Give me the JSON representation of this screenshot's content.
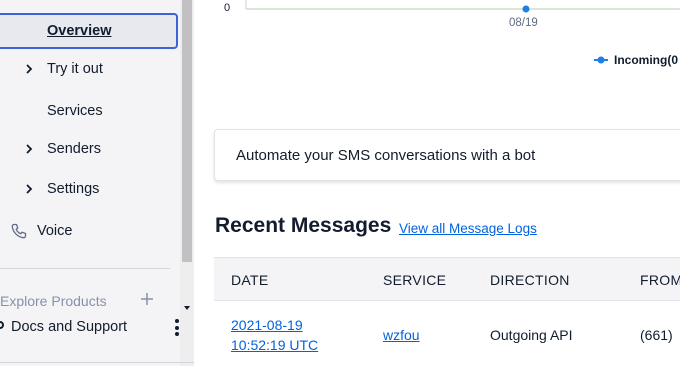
{
  "sidebar": {
    "items": [
      {
        "label": "Overview",
        "active": true,
        "chevron": false
      },
      {
        "label": "Try it out",
        "chevron": true
      },
      {
        "label": "Services",
        "chevron": false
      },
      {
        "label": "Senders",
        "chevron": true
      },
      {
        "label": "Settings",
        "chevron": true
      }
    ],
    "voice_label": "Voice",
    "explore_label": "Explore Products",
    "docs_label": "Docs and Support"
  },
  "chart_data": {
    "type": "line",
    "y_tick_labels": [
      "0"
    ],
    "x_tick_labels": [
      "08/19"
    ],
    "series": [
      {
        "name": "Incoming(0",
        "color": "#1f7ee8"
      }
    ]
  },
  "bot_card": {
    "text": "Automate your SMS conversations with a bot"
  },
  "recent": {
    "title": "Recent Messages",
    "link": "View all Message Logs",
    "columns": [
      "DATE",
      "SERVICE",
      "DIRECTION",
      "FROM"
    ],
    "rows": [
      {
        "date_line1": "2021-08-19",
        "date_line2": "10:52:19 UTC",
        "service": "wzfou",
        "direction": "Outgoing API",
        "from": "(661)"
      }
    ]
  },
  "colors": {
    "accent": "#3a64d8",
    "link": "#0263e0",
    "series": "#1f7ee8"
  }
}
